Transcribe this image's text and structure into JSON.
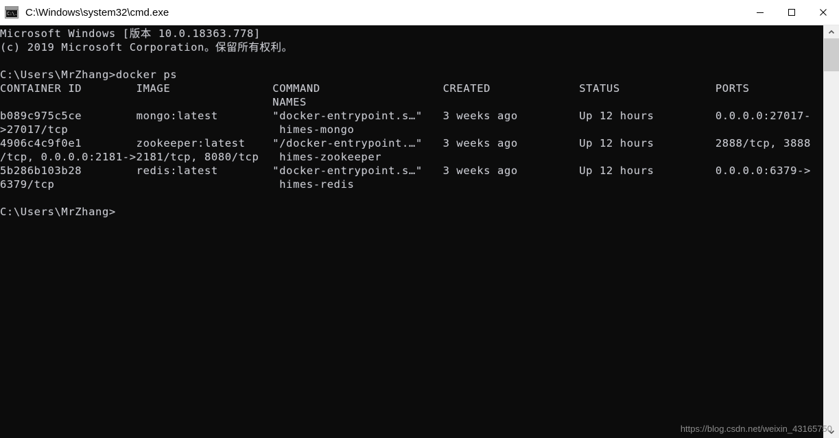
{
  "window": {
    "title": "C:\\Windows\\system32\\cmd.exe",
    "icon": "cmd-icon",
    "icon_glyph": "C:\\.",
    "background": "#0c0c0c",
    "foreground": "#ccccd0"
  },
  "titlebar": {
    "minimize_label": "Minimize",
    "maximize_label": "Maximize",
    "close_label": "Close"
  },
  "console": {
    "lines": [
      "Microsoft Windows [版本 10.0.18363.778]",
      "(c) 2019 Microsoft Corporation。保留所有权利。",
      "",
      "C:\\Users\\MrZhang>docker ps",
      "CONTAINER ID        IMAGE               COMMAND                  CREATED             STATUS              PORTS",
      "                                        NAMES",
      "b089c975c5ce        mongo:latest        \"docker-entrypoint.s…\"   3 weeks ago         Up 12 hours         0.0.0.0:27017-",
      ">27017/tcp                               himes-mongo",
      "4906c4c9f0e1        zookeeper:latest    \"/docker-entrypoint.…\"   3 weeks ago         Up 12 hours         2888/tcp, 3888",
      "/tcp, 0.0.0.0:2181->2181/tcp, 8080/tcp   himes-zookeeper",
      "5b286b103b28        redis:latest        \"docker-entrypoint.s…\"   3 weeks ago         Up 12 hours         0.0.0.0:6379->",
      "6379/tcp                                 himes-redis",
      "",
      "C:\\Users\\MrZhang>"
    ],
    "command": "docker ps",
    "prompt": "C:\\Users\\MrZhang>",
    "os_banner": "Microsoft Windows [版本 10.0.18363.778]",
    "copyright": "(c) 2019 Microsoft Corporation。保留所有权利。",
    "table": {
      "headers": [
        "CONTAINER ID",
        "IMAGE",
        "COMMAND",
        "CREATED",
        "STATUS",
        "PORTS",
        "NAMES"
      ],
      "rows": [
        {
          "container_id": "b089c975c5ce",
          "image": "mongo:latest",
          "command": "\"docker-entrypoint.s…\"",
          "created": "3 weeks ago",
          "status": "Up 12 hours",
          "ports": "0.0.0.0:27017->27017/tcp",
          "names": "himes-mongo"
        },
        {
          "container_id": "4906c4c9f0e1",
          "image": "zookeeper:latest",
          "command": "\"/docker-entrypoint.…\"",
          "created": "3 weeks ago",
          "status": "Up 12 hours",
          "ports": "2888/tcp, 3888/tcp, 0.0.0.0:2181->2181/tcp, 8080/tcp",
          "names": "himes-zookeeper"
        },
        {
          "container_id": "5b286b103b28",
          "image": "redis:latest",
          "command": "\"docker-entrypoint.s…\"",
          "created": "3 weeks ago",
          "status": "Up 12 hours",
          "ports": "0.0.0.0:6379->6379/tcp",
          "names": "himes-redis"
        }
      ]
    }
  },
  "watermark": {
    "text": "https://blog.csdn.net/weixin_43165750"
  },
  "scrollbar": {
    "up_label": "Scroll up",
    "down_label": "Scroll down"
  }
}
